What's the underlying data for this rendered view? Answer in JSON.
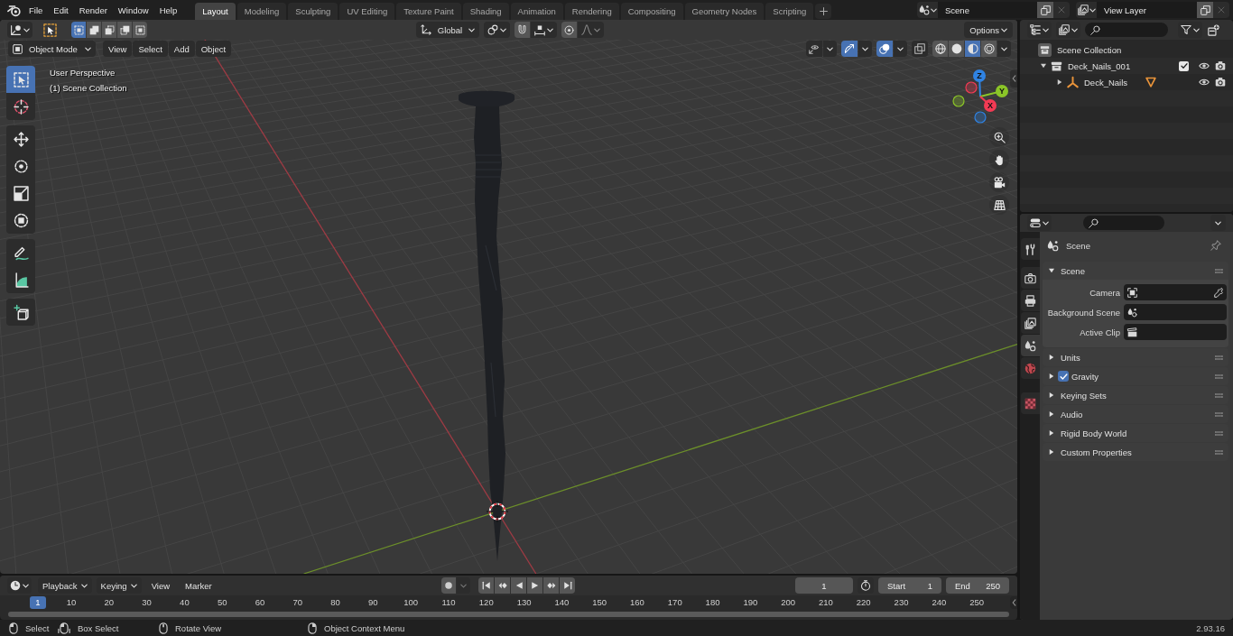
{
  "topbar": {
    "menus": [
      "File",
      "Edit",
      "Render",
      "Window",
      "Help"
    ],
    "workspaces": [
      {
        "label": "Layout",
        "selected": true
      },
      {
        "label": "Modeling",
        "selected": false
      },
      {
        "label": "Sculpting",
        "selected": false
      },
      {
        "label": "UV Editing",
        "selected": false
      },
      {
        "label": "Texture Paint",
        "selected": false
      },
      {
        "label": "Shading",
        "selected": false
      },
      {
        "label": "Animation",
        "selected": false
      },
      {
        "label": "Rendering",
        "selected": false
      },
      {
        "label": "Compositing",
        "selected": false
      },
      {
        "label": "Geometry Nodes",
        "selected": false
      },
      {
        "label": "Scripting",
        "selected": false
      }
    ],
    "scene": "Scene",
    "view_layer": "View Layer"
  },
  "viewport": {
    "select_modes": [
      {
        "kind": "set",
        "selected": true
      },
      {
        "kind": "extend",
        "selected": false
      },
      {
        "kind": "subtract",
        "selected": false
      },
      {
        "kind": "invert",
        "selected": false
      },
      {
        "kind": "intersect",
        "selected": false
      }
    ],
    "orientation": "Global",
    "options": "Options",
    "mode": "Object Mode",
    "menus": [
      "View",
      "Select",
      "Add",
      "Object"
    ],
    "toggles": [
      {
        "kind": "selectability",
        "on": false
      },
      {
        "kind": "gizmos",
        "on": true
      },
      {
        "kind": "overlays",
        "on": true
      },
      {
        "kind": "xray",
        "on": false
      }
    ],
    "shading": [
      {
        "kind": "wireframe",
        "selected": false
      },
      {
        "kind": "solid",
        "selected": false
      },
      {
        "kind": "material",
        "selected": true
      },
      {
        "kind": "rendered",
        "selected": false
      }
    ],
    "overlay_text": [
      "User Perspective",
      "(1) Scene Collection"
    ],
    "tool_groups": [
      [
        {
          "kind": "select_box",
          "selected": true
        },
        {
          "kind": "cursor",
          "selected": false
        }
      ],
      [
        {
          "kind": "move",
          "selected": false
        },
        {
          "kind": "rotate",
          "selected": false
        },
        {
          "kind": "scale",
          "selected": false
        },
        {
          "kind": "transform",
          "selected": false
        }
      ],
      [
        {
          "kind": "annotate",
          "selected": false
        },
        {
          "kind": "measure",
          "selected": false
        }
      ],
      [
        {
          "kind": "add_cube",
          "selected": false
        }
      ]
    ],
    "axes": [
      {
        "label": "Z",
        "color": "#2f83e3"
      },
      {
        "label": "Y",
        "color": "#8bc528"
      },
      {
        "label": "X",
        "color": "#f33a54"
      }
    ],
    "nav_buttons": [
      {
        "kind": "zoom"
      },
      {
        "kind": "pan"
      },
      {
        "kind": "camera"
      },
      {
        "kind": "perspective"
      }
    ]
  },
  "timeline": {
    "menus": [
      {
        "label": "Playback",
        "kind": "dropdown"
      },
      {
        "label": "Keying",
        "kind": "dropdown"
      },
      {
        "label": "View",
        "kind": "menu"
      },
      {
        "label": "Marker",
        "kind": "menu"
      }
    ],
    "transport": [
      {
        "kind": "jump_start"
      },
      {
        "kind": "prev_keyframe"
      },
      {
        "kind": "play_reverse"
      },
      {
        "kind": "play"
      },
      {
        "kind": "next_keyframe"
      },
      {
        "kind": "jump_end"
      }
    ],
    "current_frame": "1",
    "start": {
      "label": "Start",
      "value": "1"
    },
    "end": {
      "label": "End",
      "value": "250"
    },
    "frames": [
      {
        "label": "1",
        "selected": true
      },
      {
        "label": "10",
        "selected": false
      },
      {
        "label": "20",
        "selected": false
      },
      {
        "label": "30",
        "selected": false
      },
      {
        "label": "40",
        "selected": false
      },
      {
        "label": "50",
        "selected": false
      },
      {
        "label": "60",
        "selected": false
      },
      {
        "label": "70",
        "selected": false
      },
      {
        "label": "80",
        "selected": false
      },
      {
        "label": "90",
        "selected": false
      },
      {
        "label": "100",
        "selected": false
      },
      {
        "label": "110",
        "selected": false
      },
      {
        "label": "120",
        "selected": false
      },
      {
        "label": "130",
        "selected": false
      },
      {
        "label": "140",
        "selected": false
      },
      {
        "label": "150",
        "selected": false
      },
      {
        "label": "160",
        "selected": false
      },
      {
        "label": "170",
        "selected": false
      },
      {
        "label": "180",
        "selected": false
      },
      {
        "label": "190",
        "selected": false
      },
      {
        "label": "200",
        "selected": false
      },
      {
        "label": "210",
        "selected": false
      },
      {
        "label": "220",
        "selected": false
      },
      {
        "label": "230",
        "selected": false
      },
      {
        "label": "240",
        "selected": false
      },
      {
        "label": "250",
        "selected": false
      }
    ]
  },
  "outliner": {
    "tree": [
      {
        "label": "Scene Collection",
        "kind": "scene_collection",
        "children": [
          {
            "label": "Deck_Nails_001",
            "kind": "collection",
            "expanded": true,
            "checked": true,
            "children": [
              {
                "label": "Deck_Nails",
                "kind": "empty",
                "expanded": false,
                "contents": [
                  {
                    "kind": "mesh"
                  }
                ]
              }
            ]
          }
        ]
      }
    ]
  },
  "properties": {
    "tab_groups": [
      [
        {
          "kind": "tool",
          "selected": false
        }
      ],
      [
        {
          "kind": "render",
          "selected": false
        },
        {
          "kind": "output",
          "selected": false
        },
        {
          "kind": "view_layer",
          "selected": false
        },
        {
          "kind": "scene",
          "selected": true
        },
        {
          "kind": "world",
          "selected": false
        }
      ],
      [
        {
          "kind": "texture",
          "selected": false
        }
      ]
    ],
    "context": "Scene",
    "panels": [
      {
        "label": "Scene",
        "expanded": true,
        "fields": [
          {
            "label": "Camera",
            "kind": "object"
          },
          {
            "label": "Background Scene",
            "kind": "scene"
          },
          {
            "label": "Active Clip",
            "kind": "clip"
          }
        ]
      },
      {
        "label": "Units",
        "expanded": false
      },
      {
        "label": "Gravity",
        "expanded": false,
        "checked": true
      },
      {
        "label": "Keying Sets",
        "expanded": false
      },
      {
        "label": "Audio",
        "expanded": false
      },
      {
        "label": "Rigid Body World",
        "expanded": false
      },
      {
        "label": "Custom Properties",
        "expanded": false
      }
    ]
  },
  "status_bar": {
    "hints": [
      {
        "kind": "left_click",
        "label": "Select"
      },
      {
        "kind": "left_drag",
        "label": "Box Select"
      },
      {
        "kind": "middle_click",
        "label": "Rotate View"
      },
      {
        "kind": "right_click",
        "label": "Object Context Menu"
      }
    ],
    "version": "2.93.16"
  }
}
